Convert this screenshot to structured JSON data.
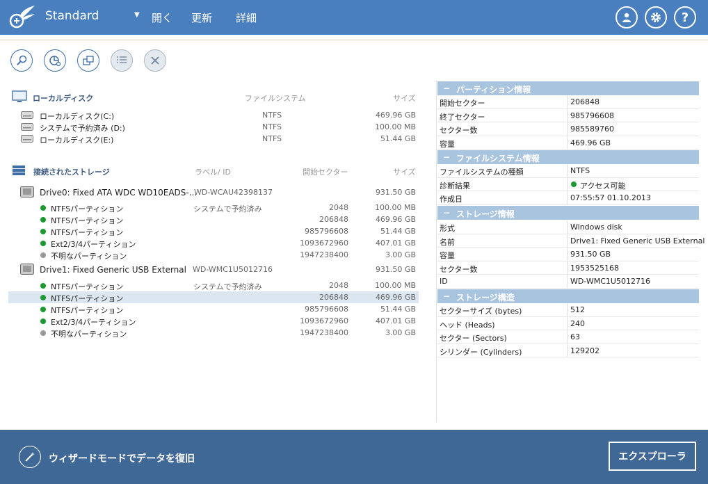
{
  "header": {
    "title": "Standard",
    "menu": [
      "開く",
      "更新",
      "詳細"
    ],
    "buttons": [
      "user-icon",
      "gear-icon",
      "help-icon"
    ]
  },
  "toolbar": {
    "buttons": [
      "search-icon",
      "pie-chart-icon",
      "clone-icon",
      "list-icon",
      "close-icon"
    ]
  },
  "local_disks": {
    "title": "ローカルディスク",
    "col_fs": "ファイルシステム",
    "col_size": "サイズ",
    "items": [
      {
        "name": "ローカルディスク(C:)",
        "fs": "NTFS",
        "size": "469.96 GB"
      },
      {
        "name": "システムで予約済み (D:)",
        "fs": "NTFS",
        "size": "100.00 MB"
      },
      {
        "name": "ローカルディスク(E:)",
        "fs": "NTFS",
        "size": "51.44 GB"
      }
    ]
  },
  "storage": {
    "title": "接続されたストレージ",
    "col_label": "ラベル/ ID",
    "col_start": "開始セクター",
    "col_size": "サイズ",
    "drives": [
      {
        "name": "Drive0: Fixed ATA WDC WD10EADS-...",
        "id": "WD-WCAU42398137",
        "size": "931.50 GB",
        "partitions": [
          {
            "name": "NTFSパーティション",
            "label": "システムで予約済み",
            "start": "2048",
            "size": "100.00 MB",
            "status": "green"
          },
          {
            "name": "NTFSパーティション",
            "label": "",
            "start": "206848",
            "size": "469.96 GB",
            "status": "green"
          },
          {
            "name": "NTFSパーティション",
            "label": "",
            "start": "985796608",
            "size": "51.44 GB",
            "status": "green"
          },
          {
            "name": "Ext2/3/4パーティション",
            "label": "",
            "start": "1093672960",
            "size": "407.01 GB",
            "status": "green"
          },
          {
            "name": "不明なパーティション",
            "label": "",
            "start": "1947238400",
            "size": "3.00 GB",
            "status": "grey"
          }
        ]
      },
      {
        "name": "Drive1: Fixed Generic USB External",
        "id": "WD-WMC1U5012716",
        "size": "931.50 GB",
        "partitions": [
          {
            "name": "NTFSパーティション",
            "label": "システムで予約済み",
            "start": "2048",
            "size": "100.00 MB",
            "status": "green"
          },
          {
            "name": "NTFSパーティション",
            "label": "",
            "start": "206848",
            "size": "469.96 GB",
            "status": "green",
            "selected": true
          },
          {
            "name": "NTFSパーティション",
            "label": "",
            "start": "985796608",
            "size": "51.44 GB",
            "status": "green"
          },
          {
            "name": "Ext2/3/4パーティション",
            "label": "",
            "start": "1093672960",
            "size": "407.01 GB",
            "status": "green"
          },
          {
            "name": "不明なパーティション",
            "label": "",
            "start": "1947238400",
            "size": "3.00 GB",
            "status": "grey"
          }
        ]
      }
    ]
  },
  "properties": [
    {
      "title": "パーティション情報",
      "rows": [
        {
          "k": "開始セクター",
          "v": "206848"
        },
        {
          "k": "終了セクター",
          "v": "985796608"
        },
        {
          "k": "セクター数",
          "v": "985589760"
        },
        {
          "k": "容量",
          "v": "469.96 GB"
        }
      ]
    },
    {
      "title": "ファイルシステム情報",
      "rows": [
        {
          "k": "ファイルシステムの種類",
          "v": "NTFS"
        },
        {
          "k": "診断結果",
          "v": "アクセス可能",
          "status": "green"
        },
        {
          "k": "作成日",
          "v": "07:55:57 01.10.2013"
        }
      ]
    },
    {
      "title": "ストレージ情報",
      "rows": [
        {
          "k": "形式",
          "v": "Windows disk"
        },
        {
          "k": "名前",
          "v": "Drive1: Fixed Generic USB External"
        },
        {
          "k": "容量",
          "v": "931.50 GB"
        },
        {
          "k": "セクター数",
          "v": "1953525168"
        },
        {
          "k": "ID",
          "v": "WD-WMC1U5012716"
        }
      ]
    },
    {
      "title": "ストレージ構造",
      "rows": [
        {
          "k": "セクターサイズ (bytes)",
          "v": "512"
        },
        {
          "k": "ヘッド (Heads)",
          "v": "240"
        },
        {
          "k": "セクター (Sectors)",
          "v": "63"
        },
        {
          "k": "シリンダー (Cylinders)",
          "v": "129202"
        }
      ]
    }
  ],
  "footer": {
    "wizard_label": "ウィザードモードでデータを復旧",
    "explorer_label": "エクスプローラ"
  }
}
